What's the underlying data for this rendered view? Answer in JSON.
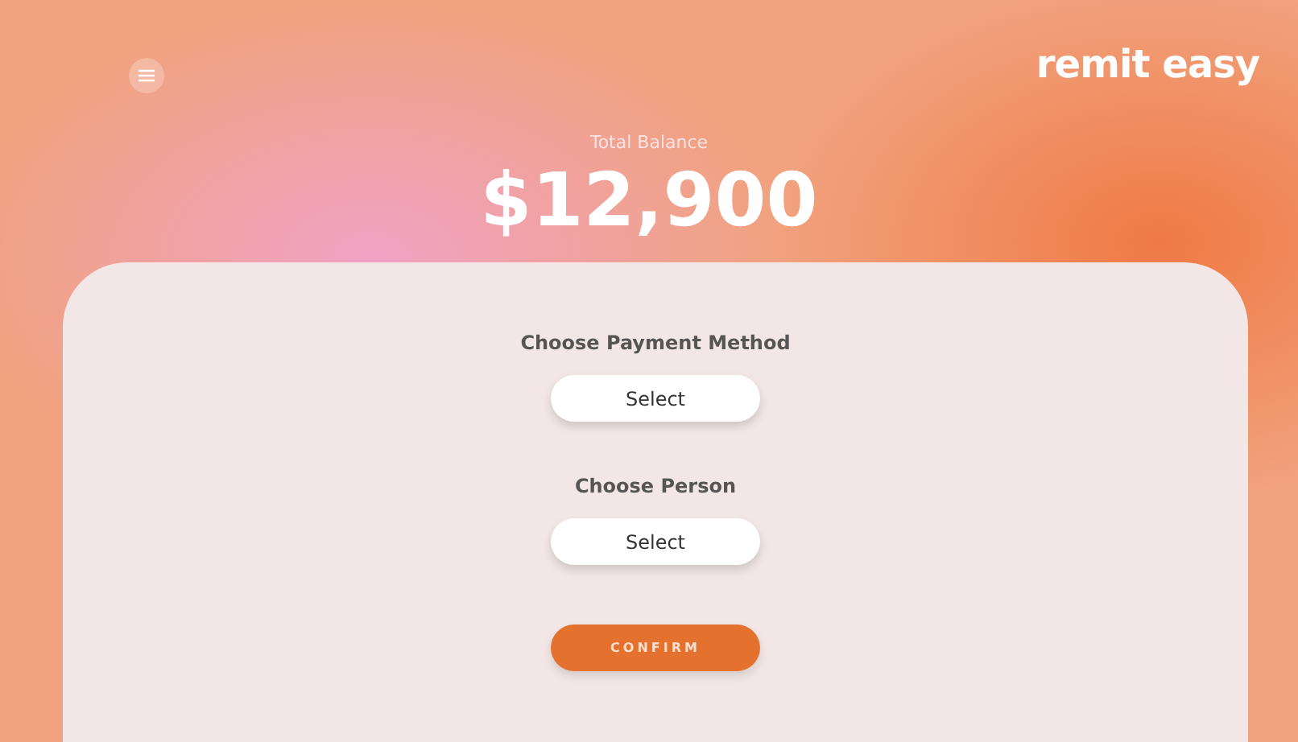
{
  "brand": "remit easy",
  "balance": {
    "label": "Total Balance",
    "amount": "$12,900"
  },
  "fields": [
    {
      "label": "Choose Payment Method",
      "value": "Select"
    },
    {
      "label": "Choose Person",
      "value": "Select"
    }
  ],
  "confirm": "CONFIRM"
}
